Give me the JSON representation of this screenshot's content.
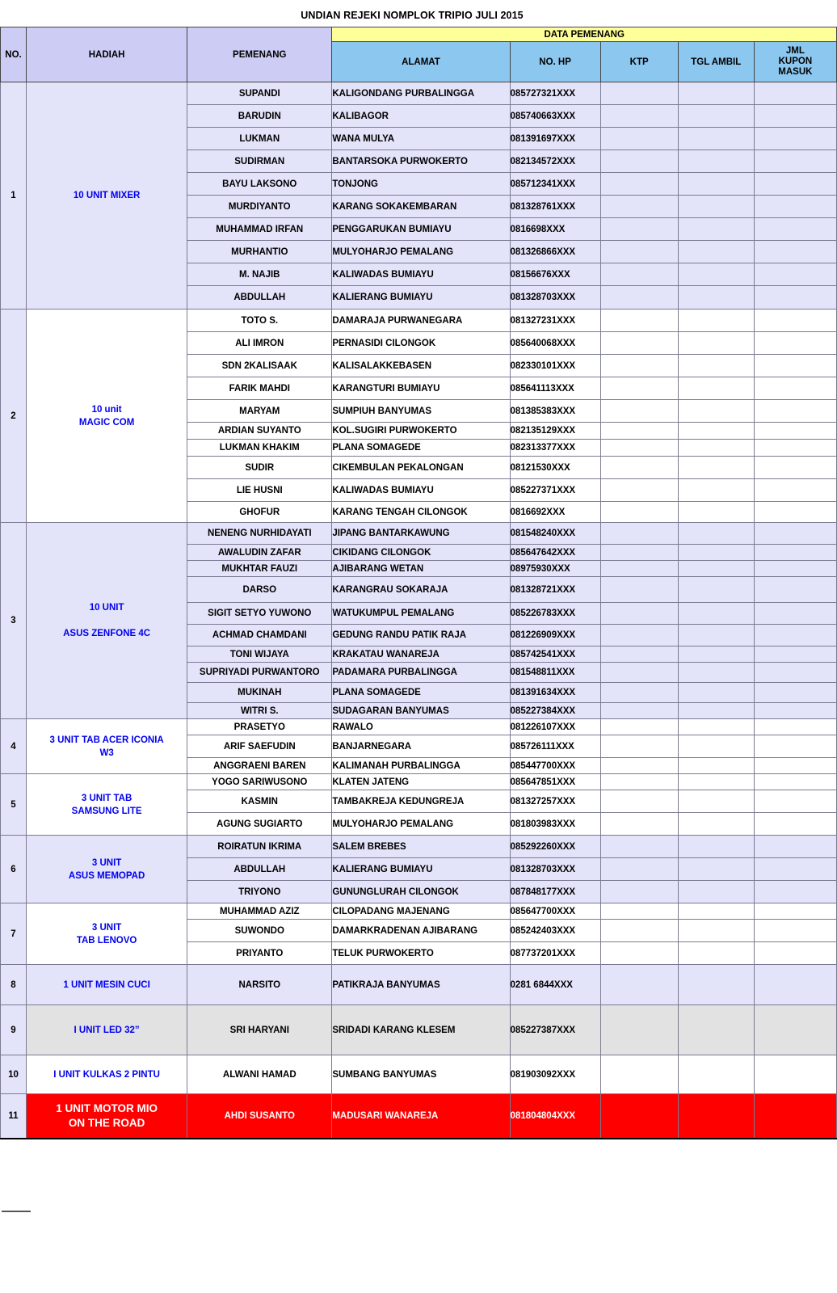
{
  "title": "UNDIAN REJEKI NOMPLOK  TRIPIO JULI 2015",
  "header": {
    "group_label": "DATA PEMENANG",
    "no": "NO.",
    "hadiah": "HADIAH",
    "pemenang": "PEMENANG",
    "alamat": "ALAMAT",
    "no_hp": "NO. HP",
    "ktp": "KTP",
    "tgl_ambil": "TGL AMBIL",
    "jml_kupon_masuk": "JML\nKUPON\nMASUK",
    "jml_l1": "JML",
    "jml_l2": "KUPON",
    "jml_l3": "MASUK"
  },
  "colors": {
    "group_header_fill": "#ffff99",
    "header_fill": "#8cc7f0",
    "header_lavender_fill": "#ccccf5",
    "row_lavender_fill": "#e3e3fa",
    "row_white_fill": "#ffffff",
    "row_gray_fill": "#e2e2e2",
    "row_red_fill": "#fe0000",
    "prize_text": "#0000ee"
  },
  "groups": [
    {
      "no": "1",
      "hadiah": "10 UNIT MIXER",
      "hadiah_lines": [
        "10 UNIT MIXER"
      ],
      "fill": "lav",
      "rows": [
        {
          "pemenang": "SUPANDI",
          "alamat": "KALIGONDANG PURBALINGGA",
          "no_hp": "085727321XXX",
          "ktp": "",
          "tgl_ambil": "",
          "jml": ""
        },
        {
          "pemenang": "BARUDIN",
          "alamat": "KALIBAGOR",
          "no_hp": "085740663XXX",
          "ktp": "",
          "tgl_ambil": "",
          "jml": ""
        },
        {
          "pemenang": "LUKMAN",
          "alamat": "WANA MULYA",
          "no_hp": "081391697XXX",
          "ktp": "",
          "tgl_ambil": "",
          "jml": ""
        },
        {
          "pemenang": "SUDIRMAN",
          "alamat": "BANTARSOKA PURWOKERTO",
          "no_hp": "082134572XXX",
          "ktp": "",
          "tgl_ambil": "",
          "jml": ""
        },
        {
          "pemenang": "BAYU LAKSONO",
          "alamat": "TONJONG",
          "no_hp": "085712341XXX",
          "ktp": "",
          "tgl_ambil": "",
          "jml": ""
        },
        {
          "pemenang": "MURDIYANTO",
          "alamat": "KARANG SOKAKEMBARAN",
          "no_hp": "081328761XXX",
          "ktp": "",
          "tgl_ambil": "",
          "jml": ""
        },
        {
          "pemenang": "MUHAMMAD IRFAN",
          "alamat": "PENGGARUKAN BUMIAYU",
          "no_hp": "0816698XXX",
          "ktp": "",
          "tgl_ambil": "",
          "jml": ""
        },
        {
          "pemenang": "MURHANTIO",
          "alamat": "MULYOHARJO PEMALANG",
          "no_hp": "081326866XXX",
          "ktp": "",
          "tgl_ambil": "",
          "jml": ""
        },
        {
          "pemenang": "M. NAJIB",
          "alamat": "KALIWADAS BUMIAYU",
          "no_hp": "08156676XXX",
          "ktp": "",
          "tgl_ambil": "",
          "jml": ""
        },
        {
          "pemenang": "ABDULLAH",
          "alamat": "KALIERANG BUMIAYU",
          "no_hp": "081328703XXX",
          "ktp": "",
          "tgl_ambil": "",
          "jml": ""
        }
      ]
    },
    {
      "no": "2",
      "hadiah": "10 unit MAGIC COM",
      "hadiah_lines": [
        "10 unit",
        "MAGIC COM"
      ],
      "fill": "white",
      "rows": [
        {
          "pemenang": "TOTO S.",
          "alamat": "DAMARAJA PURWANEGARA",
          "no_hp": "081327231XXX",
          "ktp": "",
          "tgl_ambil": "",
          "jml": ""
        },
        {
          "pemenang": "ALI IMRON",
          "alamat": "PERNASIDI CILONGOK",
          "no_hp": "085640068XXX",
          "ktp": "",
          "tgl_ambil": "",
          "jml": ""
        },
        {
          "pemenang": "SDN 2KALISAAK",
          "alamat": "KALISALAKKEBASEN",
          "no_hp": "082330101XXX",
          "ktp": "",
          "tgl_ambil": "",
          "jml": ""
        },
        {
          "pemenang": "FARIK MAHDI",
          "alamat": "KARANGTURI BUMIAYU",
          "no_hp": "085641113XXX",
          "ktp": "",
          "tgl_ambil": "",
          "jml": ""
        },
        {
          "pemenang": "MARYAM",
          "alamat": "SUMPIUH BANYUMAS",
          "no_hp": "081385383XXX",
          "ktp": "",
          "tgl_ambil": "",
          "jml": ""
        },
        {
          "pemenang": "ARDIAN SUYANTO",
          "alamat": "KOL.SUGIRI PURWOKERTO",
          "no_hp": "082135129XXX",
          "ktp": "",
          "tgl_ambil": "",
          "jml": ""
        },
        {
          "pemenang": "LUKMAN KHAKIM",
          "alamat": "PLANA SOMAGEDE",
          "no_hp": "082313377XXX",
          "ktp": "",
          "tgl_ambil": "",
          "jml": ""
        },
        {
          "pemenang": "SUDIR",
          "alamat": "CIKEMBULAN PEKALONGAN",
          "no_hp": "08121530XXX",
          "ktp": "",
          "tgl_ambil": "",
          "jml": ""
        },
        {
          "pemenang": "LIE HUSNI",
          "alamat": "KALIWADAS BUMIAYU",
          "no_hp": "085227371XXX",
          "ktp": "",
          "tgl_ambil": "",
          "jml": ""
        },
        {
          "pemenang": "GHOFUR",
          "alamat": "KARANG TENGAH CILONGOK",
          "no_hp": "0816692XXX",
          "ktp": "",
          "tgl_ambil": "",
          "jml": ""
        }
      ]
    },
    {
      "no": "3",
      "hadiah": "10 UNIT ASUS ZENFONE 4C",
      "hadiah_lines": [
        "10 UNIT",
        "",
        "ASUS ZENFONE 4C"
      ],
      "fill": "lav",
      "rows": [
        {
          "pemenang": "NENENG NURHIDAYATI",
          "alamat": "JIPANG BANTARKAWUNG",
          "no_hp": "081548240XXX",
          "ktp": "",
          "tgl_ambil": "",
          "jml": ""
        },
        {
          "pemenang": "AWALUDIN ZAFAR",
          "alamat": "CIKIDANG CILONGOK",
          "no_hp": "085647642XXX",
          "ktp": "",
          "tgl_ambil": "",
          "jml": ""
        },
        {
          "pemenang": "MUKHTAR FAUZI",
          "alamat": "AJIBARANG WETAN",
          "no_hp": "08975930XXX",
          "ktp": "",
          "tgl_ambil": "",
          "jml": ""
        },
        {
          "pemenang": "DARSO",
          "alamat": "KARANGRAU SOKARAJA",
          "no_hp": "081328721XXX",
          "ktp": "",
          "tgl_ambil": "",
          "jml": ""
        },
        {
          "pemenang": "SIGIT SETYO YUWONO",
          "alamat": "WATUKUMPUL PEMALANG",
          "no_hp": "085226783XXX",
          "ktp": "",
          "tgl_ambil": "",
          "jml": ""
        },
        {
          "pemenang": "ACHMAD CHAMDANI",
          "alamat": "GEDUNG RANDU PATIK RAJA",
          "no_hp": "081226909XXX",
          "ktp": "",
          "tgl_ambil": "",
          "jml": ""
        },
        {
          "pemenang": "TONI WIJAYA",
          "alamat": "KRAKATAU WANAREJA",
          "no_hp": "085742541XXX",
          "ktp": "",
          "tgl_ambil": "",
          "jml": ""
        },
        {
          "pemenang": "SUPRIYADI PURWANTORO",
          "alamat": "PADAMARA PURBALINGGA",
          "no_hp": "081548811XXX",
          "ktp": "",
          "tgl_ambil": "",
          "jml": ""
        },
        {
          "pemenang": "MUKINAH",
          "alamat": "PLANA SOMAGEDE",
          "no_hp": "081391634XXX",
          "ktp": "",
          "tgl_ambil": "",
          "jml": ""
        },
        {
          "pemenang": "WITRI S.",
          "alamat": "SUDAGARAN BANYUMAS",
          "no_hp": "085227384XXX",
          "ktp": "",
          "tgl_ambil": "",
          "jml": ""
        }
      ]
    },
    {
      "no": "4",
      "hadiah": "3 UNIT TAB ACER ICONIA W3",
      "hadiah_lines": [
        "3 UNIT TAB ACER ICONIA",
        "W3"
      ],
      "fill": "white",
      "rows": [
        {
          "pemenang": "PRASETYO",
          "alamat": "RAWALO",
          "no_hp": "081226107XXX",
          "ktp": "",
          "tgl_ambil": "",
          "jml": ""
        },
        {
          "pemenang": "ARIF SAEFUDIN",
          "alamat": "BANJARNEGARA",
          "no_hp": "085726111XXX",
          "ktp": "",
          "tgl_ambil": "",
          "jml": ""
        },
        {
          "pemenang": "ANGGRAENI BAREN",
          "alamat": "KALIMANAH PURBALINGGA",
          "no_hp": "085447700XXX",
          "ktp": "",
          "tgl_ambil": "",
          "jml": ""
        }
      ]
    },
    {
      "no": "5",
      "hadiah": "3 UNIT  TAB SAMSUNG  LITE",
      "hadiah_lines": [
        "3 UNIT  TAB",
        "SAMSUNG  LITE"
      ],
      "fill": "white",
      "rows": [
        {
          "pemenang": "YOGO SARIWUSONO",
          "alamat": "KLATEN JATENG",
          "no_hp": "085647851XXX",
          "ktp": "",
          "tgl_ambil": "",
          "jml": ""
        },
        {
          "pemenang": "KASMIN",
          "alamat": "TAMBAKREJA  KEDUNGREJA",
          "no_hp": "081327257XXX",
          "ktp": "",
          "tgl_ambil": "",
          "jml": ""
        },
        {
          "pemenang": "AGUNG SUGIARTO",
          "alamat": "MULYOHARJO PEMALANG",
          "no_hp": "081803983XXX",
          "ktp": "",
          "tgl_ambil": "",
          "jml": ""
        }
      ]
    },
    {
      "no": "6",
      "hadiah": "3 UNIT ASUS MEMOPAD",
      "hadiah_lines": [
        "3 UNIT",
        "ASUS MEMOPAD"
      ],
      "fill": "lav",
      "rows": [
        {
          "pemenang": "ROIRATUN IKRIMA",
          "alamat": "SALEM BREBES",
          "no_hp": "085292260XXX",
          "ktp": "",
          "tgl_ambil": "",
          "jml": ""
        },
        {
          "pemenang": "ABDULLAH",
          "alamat": "KALIERANG BUMIAYU",
          "no_hp": "081328703XXX",
          "ktp": "",
          "tgl_ambil": "",
          "jml": ""
        },
        {
          "pemenang": "TRIYONO",
          "alamat": "GUNUNGLURAH CILONGOK",
          "no_hp": "087848177XXX",
          "ktp": "",
          "tgl_ambil": "",
          "jml": ""
        }
      ]
    },
    {
      "no": "7",
      "hadiah": "3 UNIT TAB LENOVO",
      "hadiah_lines": [
        "3 UNIT",
        "TAB LENOVO"
      ],
      "fill": "white",
      "rows": [
        {
          "pemenang": "MUHAMMAD AZIZ",
          "alamat": "CILOPADANG MAJENANG",
          "no_hp": "085647700XXX",
          "ktp": "",
          "tgl_ambil": "",
          "jml": ""
        },
        {
          "pemenang": "SUWONDO",
          "alamat": "DAMARKRADENAN AJIBARANG",
          "no_hp": "085242403XXX",
          "ktp": "",
          "tgl_ambil": "",
          "jml": ""
        },
        {
          "pemenang": "PRIYANTO",
          "alamat": "TELUK PURWOKERTO",
          "no_hp": "087737201XXX",
          "ktp": "",
          "tgl_ambil": "",
          "jml": ""
        }
      ]
    },
    {
      "no": "8",
      "hadiah": "1 UNIT  MESIN CUCI",
      "hadiah_lines": [
        "1 UNIT  MESIN CUCI"
      ],
      "fill": "lav",
      "rows": [
        {
          "pemenang": "NARSITO",
          "alamat": "PATIKRAJA BANYUMAS",
          "no_hp": "0281 6844XXX",
          "ktp": "",
          "tgl_ambil": "",
          "jml": ""
        }
      ]
    },
    {
      "no": "9",
      "hadiah": "I UNIT LED 32”",
      "hadiah_lines": [
        "I UNIT LED 32”"
      ],
      "fill": "gray",
      "rows": [
        {
          "pemenang": "SRI HARYANI",
          "alamat": "SRIDADI KARANG KLESEM",
          "no_hp": "085227387XXX",
          "ktp": "",
          "tgl_ambil": "",
          "jml": ""
        }
      ]
    },
    {
      "no": "10",
      "hadiah": "I UNIT KULKAS 2 PINTU",
      "hadiah_lines": [
        "I UNIT KULKAS 2 PINTU"
      ],
      "fill": "white",
      "rows": [
        {
          "pemenang": "ALWANI HAMAD",
          "alamat": "SUMBANG BANYUMAS",
          "no_hp": "081903092XXX",
          "ktp": "",
          "tgl_ambil": "",
          "jml": ""
        }
      ]
    },
    {
      "no": "11",
      "hadiah": "1 UNIT MOTOR MIO ON THE ROAD",
      "hadiah_lines": [
        "1 UNIT MOTOR MIO",
        "ON THE ROAD"
      ],
      "fill": "red",
      "rows": [
        {
          "pemenang": "AHDI SUSANTO",
          "alamat": "MADUSARI WANAREJA",
          "no_hp": "081804804XXX",
          "ktp": "",
          "tgl_ambil": "",
          "jml": ""
        }
      ]
    }
  ]
}
